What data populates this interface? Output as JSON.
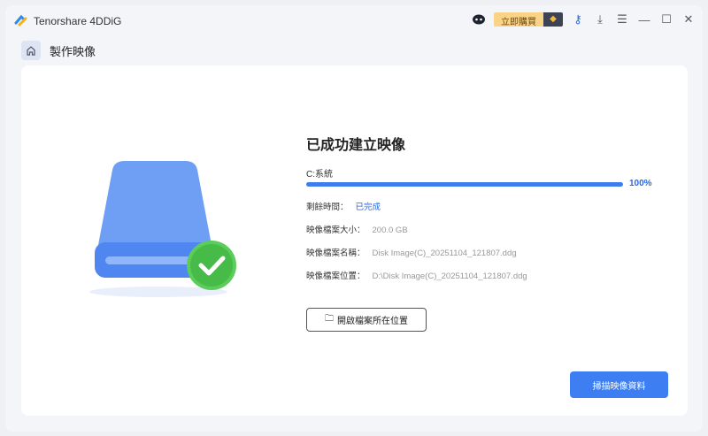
{
  "app": {
    "title": "Tenorshare 4DDiG",
    "buy_label": "立即購買"
  },
  "breadcrumb": {
    "label": "製作映像"
  },
  "result": {
    "title": "已成功建立映像",
    "drive": "C:系統",
    "progress_percent": 100,
    "progress_label": "100%",
    "rows": [
      {
        "label": "剩餘時間：",
        "value": "已完成"
      },
      {
        "label": "映像檔案大小：",
        "value": "200.0 GB"
      },
      {
        "label": "映像檔案名稱：",
        "value": "Disk Image(C)_20251104_121807.ddg"
      },
      {
        "label": "映像檔案位置：",
        "value": "D:\\Disk Image(C)_20251104_121807.ddg"
      }
    ],
    "open_button": "開啟檔案所在位置",
    "scan_button": "掃描映像資料"
  },
  "colors": {
    "accent": "#3d7ef2"
  }
}
